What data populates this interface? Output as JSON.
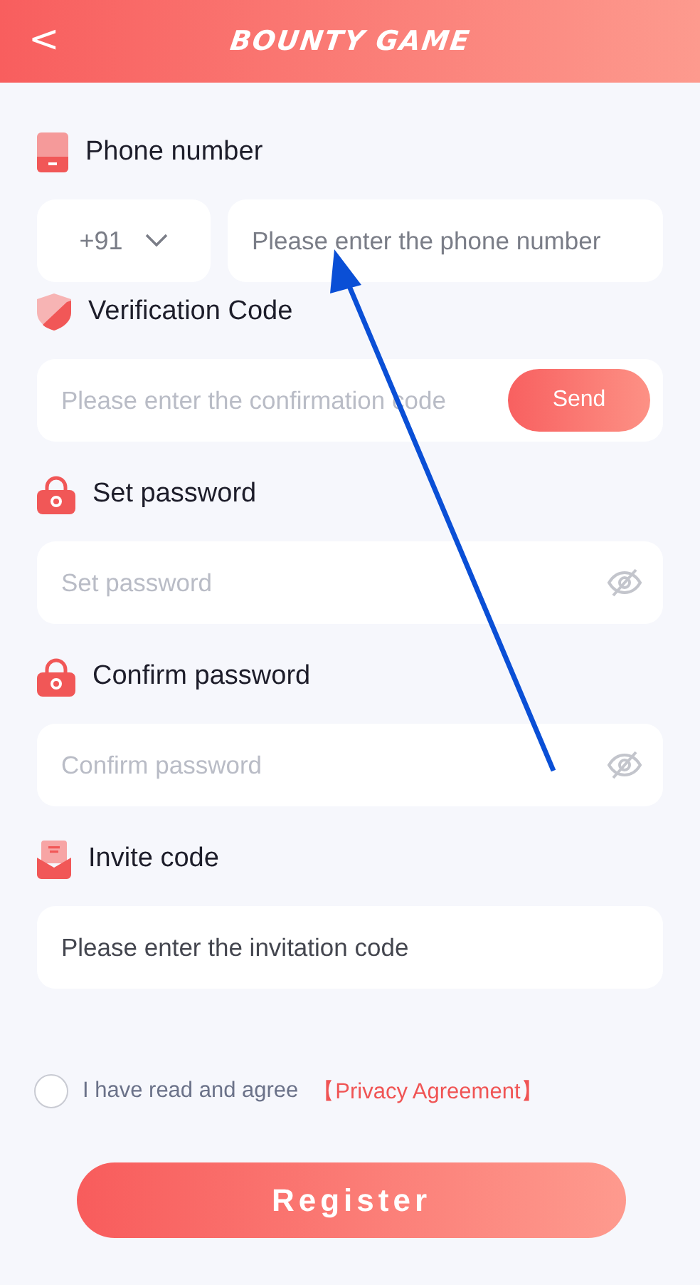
{
  "header": {
    "back": "<",
    "title": "BOUNTY GAME"
  },
  "sections": [
    {
      "label": "Phone number",
      "fields": [
        {
          "kind": "country",
          "value": "+91"
        },
        {
          "kind": "text",
          "placeholder": "Please enter the phone number"
        }
      ]
    },
    {
      "label": "Verification Code",
      "fields": [
        {
          "kind": "code",
          "placeholder": "Please enter the confirmation code",
          "button": "Send"
        }
      ]
    },
    {
      "label": "Set password",
      "fields": [
        {
          "kind": "password",
          "placeholder": "Set password"
        }
      ]
    },
    {
      "label": "Confirm password",
      "fields": [
        {
          "kind": "password",
          "placeholder": "Confirm password"
        }
      ]
    },
    {
      "label": "Invite code",
      "fields": [
        {
          "kind": "invite",
          "placeholder": "Please enter the invitation code"
        }
      ]
    }
  ],
  "agreement": {
    "checked": false,
    "text": "I have read and agree",
    "link": "【Privacy Agreement】"
  },
  "register": "Register"
}
